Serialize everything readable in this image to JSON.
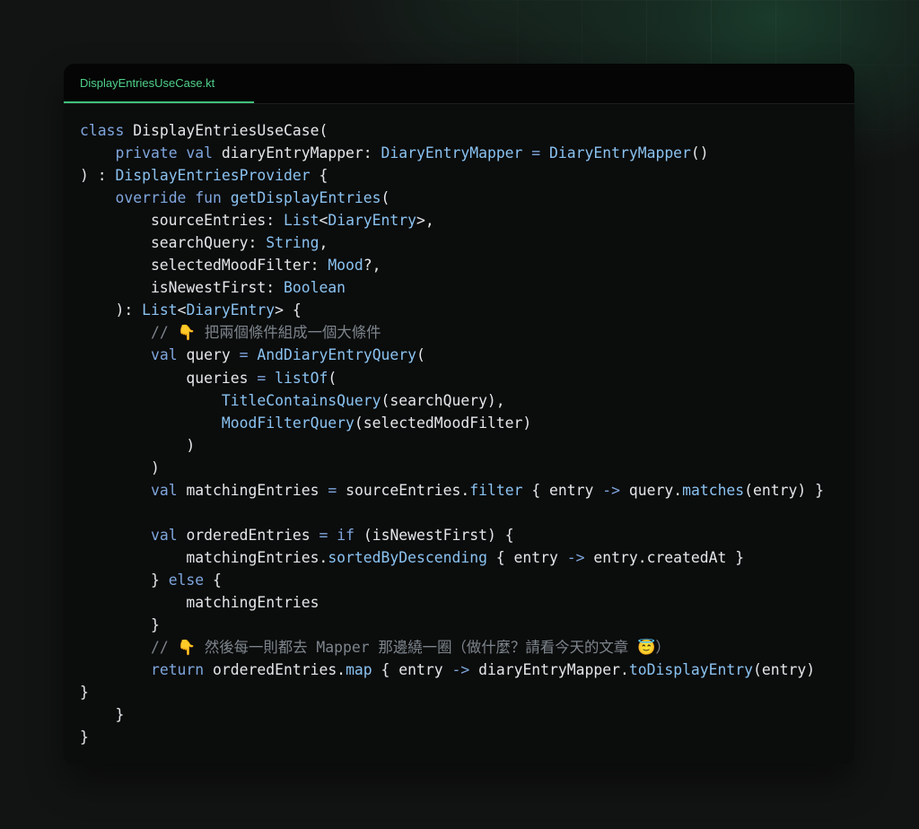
{
  "tab": {
    "filename": "DisplayEntriesUseCase.kt"
  },
  "colors": {
    "tab_active": "#4fd08a",
    "keyword": "#7fa6dd",
    "type": "#8ac2f0",
    "comment": "#7d858c",
    "plain": "#e4e7ea"
  },
  "code": {
    "lines": [
      [
        [
          "kw",
          "class "
        ],
        [
          "p",
          "DisplayEntriesUseCase("
        ]
      ],
      [
        [
          "p",
          "    "
        ],
        [
          "kw",
          "private val "
        ],
        [
          "p",
          "diaryEntryMapper: "
        ],
        [
          "ty",
          "DiaryEntryMapper"
        ],
        [
          "op",
          " = "
        ],
        [
          "ty",
          "DiaryEntryMapper"
        ],
        [
          "p",
          "()"
        ]
      ],
      [
        [
          "p",
          ") : "
        ],
        [
          "ty",
          "DisplayEntriesProvider"
        ],
        [
          "p",
          " {"
        ]
      ],
      [
        [
          "p",
          "    "
        ],
        [
          "kw",
          "override fun "
        ],
        [
          "fn",
          "getDisplayEntries"
        ],
        [
          "p",
          "("
        ]
      ],
      [
        [
          "p",
          "        sourceEntries: "
        ],
        [
          "ty",
          "List"
        ],
        [
          "p",
          "<"
        ],
        [
          "ty",
          "DiaryEntry"
        ],
        [
          "p",
          ">,"
        ]
      ],
      [
        [
          "p",
          "        searchQuery: "
        ],
        [
          "ty",
          "String"
        ],
        [
          "p",
          ","
        ]
      ],
      [
        [
          "p",
          "        selectedMoodFilter: "
        ],
        [
          "ty",
          "Mood"
        ],
        [
          "p",
          "?,"
        ]
      ],
      [
        [
          "p",
          "        isNewestFirst: "
        ],
        [
          "ty",
          "Boolean"
        ]
      ],
      [
        [
          "p",
          "    ): "
        ],
        [
          "ty",
          "List"
        ],
        [
          "p",
          "<"
        ],
        [
          "ty",
          "DiaryEntry"
        ],
        [
          "p",
          "> {"
        ]
      ],
      [
        [
          "p",
          "        "
        ],
        [
          "cm",
          "// 👇 把兩個條件組成一個大條件"
        ]
      ],
      [
        [
          "p",
          "        "
        ],
        [
          "kw",
          "val "
        ],
        [
          "p",
          "query "
        ],
        [
          "op",
          "= "
        ],
        [
          "fn",
          "AndDiaryEntryQuery"
        ],
        [
          "p",
          "("
        ]
      ],
      [
        [
          "p",
          "            queries "
        ],
        [
          "op",
          "= "
        ],
        [
          "fn",
          "listOf"
        ],
        [
          "p",
          "("
        ]
      ],
      [
        [
          "p",
          "                "
        ],
        [
          "fn",
          "TitleContainsQuery"
        ],
        [
          "p",
          "(searchQuery),"
        ]
      ],
      [
        [
          "p",
          "                "
        ],
        [
          "fn",
          "MoodFilterQuery"
        ],
        [
          "p",
          "(selectedMoodFilter)"
        ]
      ],
      [
        [
          "p",
          "            )"
        ]
      ],
      [
        [
          "p",
          "        )"
        ]
      ],
      [
        [
          "p",
          "        "
        ],
        [
          "kw",
          "val "
        ],
        [
          "p",
          "matchingEntries "
        ],
        [
          "op",
          "= "
        ],
        [
          "p",
          "sourceEntries."
        ],
        [
          "fn",
          "filter"
        ],
        [
          "p",
          " { entry "
        ],
        [
          "op",
          "->"
        ],
        [
          "p",
          " query."
        ],
        [
          "fn",
          "matches"
        ],
        [
          "p",
          "(entry) }"
        ]
      ],
      [
        [
          "p",
          ""
        ]
      ],
      [
        [
          "p",
          "        "
        ],
        [
          "kw",
          "val "
        ],
        [
          "p",
          "orderedEntries "
        ],
        [
          "op",
          "= "
        ],
        [
          "kw",
          "if"
        ],
        [
          "p",
          " (isNewestFirst) {"
        ]
      ],
      [
        [
          "p",
          "            matchingEntries."
        ],
        [
          "fn",
          "sortedByDescending"
        ],
        [
          "p",
          " { entry "
        ],
        [
          "op",
          "->"
        ],
        [
          "p",
          " entry.createdAt }"
        ]
      ],
      [
        [
          "p",
          "        } "
        ],
        [
          "kw",
          "else"
        ],
        [
          "p",
          " {"
        ]
      ],
      [
        [
          "p",
          "            matchingEntries"
        ]
      ],
      [
        [
          "p",
          "        }"
        ]
      ],
      [
        [
          "p",
          "        "
        ],
        [
          "cm",
          "// 👇 然後每一則都去 Mapper 那邊繞一圈（做什麼？請看今天的文章 😇）"
        ]
      ],
      [
        [
          "p",
          "        "
        ],
        [
          "kw",
          "return "
        ],
        [
          "p",
          "orderedEntries."
        ],
        [
          "fn",
          "map"
        ],
        [
          "p",
          " { entry "
        ],
        [
          "op",
          "->"
        ],
        [
          "p",
          " diaryEntryMapper."
        ],
        [
          "fn",
          "toDisplayEntry"
        ],
        [
          "p",
          "(entry)"
        ]
      ],
      [
        [
          "p",
          "}"
        ]
      ],
      [
        [
          "p",
          "    }"
        ]
      ],
      [
        [
          "p",
          "}"
        ]
      ]
    ]
  }
}
